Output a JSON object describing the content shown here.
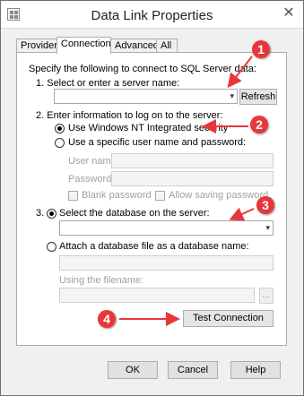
{
  "window": {
    "title": "Data Link Properties",
    "close_glyph": "✕"
  },
  "tabs": [
    {
      "label": "Provider"
    },
    {
      "label": "Connection"
    },
    {
      "label": "Advanced"
    },
    {
      "label": "All"
    }
  ],
  "connection": {
    "intro": "Specify the following to connect to SQL Server data:",
    "step1_label": "1. Select or enter a server name:",
    "server_value": "",
    "refresh_label": "Refresh",
    "step2_label": "2. Enter information to log on to the server:",
    "windows_auth_label": "Use Windows NT Integrated security",
    "specific_user_label": "Use a specific user name and password:",
    "username_label": "User name:",
    "password_label": "Password:",
    "blank_password_label": "Blank password",
    "allow_saving_label": "Allow saving password",
    "step3_label": "3.",
    "select_db_label": "Select the database on the server:",
    "database_value": "",
    "attach_db_label": "Attach a database file as a database name:",
    "filename_label": "Using the filename:",
    "browse_label": "...",
    "test_connection_label": "Test Connection"
  },
  "buttons": {
    "ok": "OK",
    "cancel": "Cancel",
    "help": "Help"
  },
  "annotations": {
    "marker_1": "1",
    "marker_2": "2",
    "marker_3": "3",
    "marker_4": "4",
    "color": "#e8373a"
  },
  "icons": {
    "dropdown": "▾"
  }
}
